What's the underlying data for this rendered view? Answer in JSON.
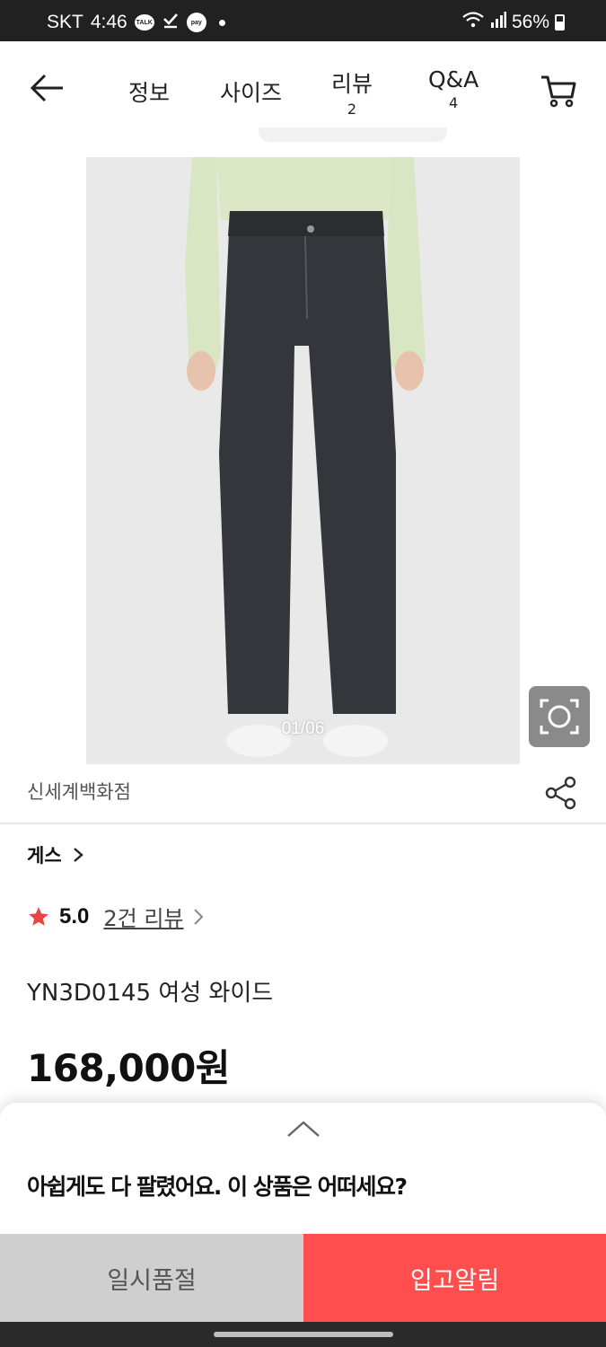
{
  "status_bar": {
    "carrier": "SKT",
    "time": "4:46",
    "talk_label": "TALK",
    "pay_label": "pay",
    "battery": "56%"
  },
  "header": {
    "tabs": [
      {
        "label": "정보",
        "count": ""
      },
      {
        "label": "사이즈",
        "count": ""
      },
      {
        "label": "리뷰",
        "count": "2"
      },
      {
        "label": "Q&A",
        "count": "4"
      }
    ]
  },
  "product": {
    "image_counter": "01/06",
    "seller": "신세계백화점",
    "brand": "게스",
    "rating": "5.0",
    "review_link": "2건 리뷰",
    "title": "YN3D0145 여성 와이드",
    "price": "168,000원"
  },
  "sheet": {
    "title": "아쉽게도 다 팔렸어요. 이 상품은 어떠세요?"
  },
  "actions": {
    "soldout_label": "일시품절",
    "notify_label": "입고알림"
  },
  "colors": {
    "accent": "#ff4e4e",
    "star": "#e94545",
    "soldout_bg": "#cfcfcf"
  },
  "icons": [
    "back-arrow-icon",
    "cart-icon",
    "lens-search-icon",
    "share-icon",
    "chevron-right-icon",
    "star-icon",
    "chevron-up-icon"
  ]
}
